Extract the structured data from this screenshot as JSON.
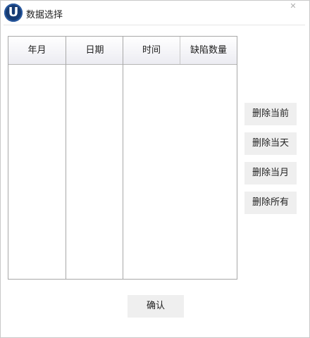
{
  "window": {
    "title": "数据选择",
    "logo_letter": "U",
    "close_glyph": "✕"
  },
  "columns": {
    "year_header": "年月",
    "date_header": "日期",
    "time_header": "时间",
    "defect_count_header": "缺陷数量"
  },
  "actions": {
    "delete_current": "删除当前",
    "delete_day": "删除当天",
    "delete_month": "删除当月",
    "delete_all": "删除所有"
  },
  "footer": {
    "confirm": "确认"
  },
  "colors": {
    "logo_bg": "#163b73",
    "button_bg": "#efefef",
    "border": "#a8a8a8"
  }
}
